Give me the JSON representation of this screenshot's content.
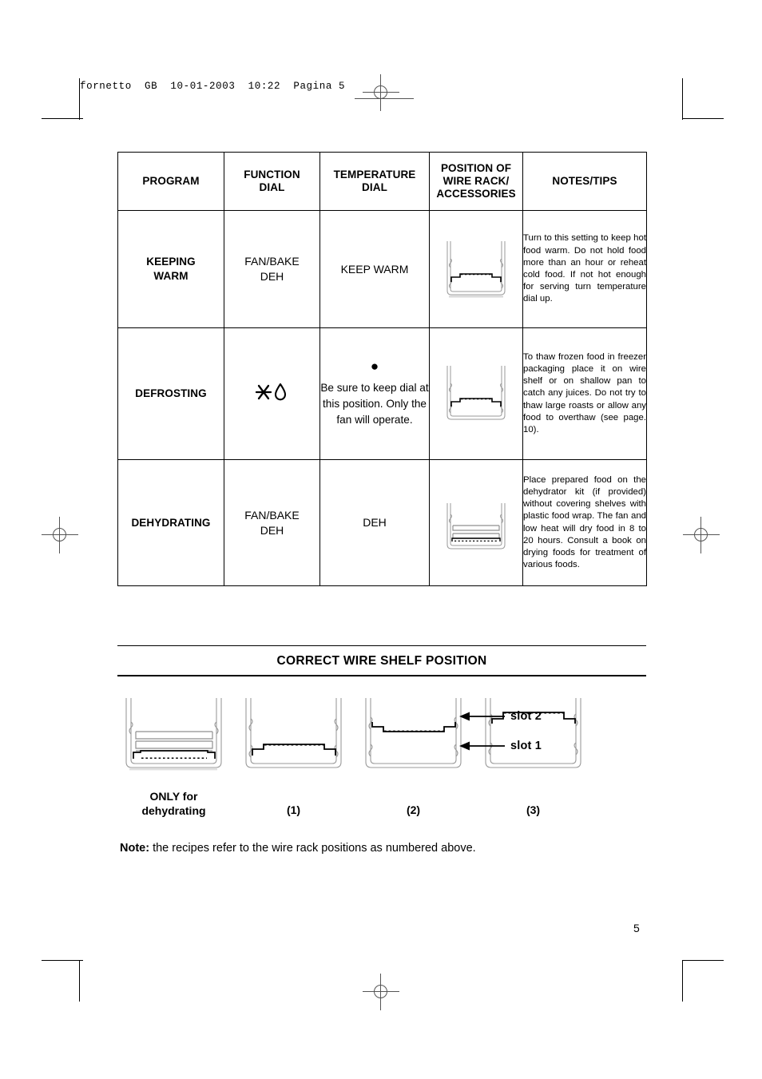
{
  "page": {
    "slug": "fornetto  GB  10-01-2003  10:22  Pagina 5",
    "number": "5"
  },
  "table": {
    "headers": [
      "PROGRAM",
      "FUNCTION\nDIAL",
      "TEMPERATURE\nDIAL",
      "POSITION OF\nWIRE RACK/\nACCESSORIES",
      "NOTES/TIPS"
    ],
    "headers_flat": {
      "program": "PROGRAM",
      "function_dial": "FUNCTION DIAL",
      "temperature_dial": "TEMPERATURE DIAL",
      "position": "POSITION OF WIRE RACK/ ACCESSORIES",
      "notes": "NOTES/TIPS"
    },
    "rows": [
      {
        "program": "KEEPING WARM",
        "function_dial": "FAN/BAKE DEH",
        "temperature_dial": "KEEP WARM",
        "temperature_dot": "",
        "position_icon": "oven-shelf-slot-1-icon",
        "notes": "Turn to this setting to keep hot food warm. Do not hold food more than an hour or reheat cold food. If not hot enough for serving turn temperature dial up."
      },
      {
        "program": "DEFROSTING",
        "function_dial": "✳◊",
        "function_dial_icon": "defrost-snowflake-drop-icon",
        "temperature_dial": "Be sure to keep dial at this position. Only the fan will operate.",
        "temperature_dot": "●",
        "position_icon": "oven-shelf-slot-1-icon",
        "notes": "To thaw frozen food in freezer packaging place it on wire shelf or on shallow pan to catch any juices. Do not try to thaw large roasts or allow any food to overthaw (see page. 10)."
      },
      {
        "program": "DEHYDRATING",
        "function_dial": "FAN/BAKE DEH",
        "temperature_dial": "DEH",
        "temperature_dot": "",
        "position_icon": "oven-dehydrator-kit-icon",
        "notes": "Place prepared food on the dehydrator kit (if provided) without covering shelves with plastic food wrap. The fan and low heat will dry food in 8 to 20 hours. Consult a book on drying foods for treatment of various foods."
      }
    ]
  },
  "shelf_section": {
    "title": "CORRECT WIRE SHELF POSITION",
    "diagrams": [
      {
        "icon": "oven-dehydrator-kit-icon",
        "caption": "ONLY for dehydrating"
      },
      {
        "icon": "oven-shelf-position-1-icon",
        "caption": "(1)"
      },
      {
        "icon": "oven-shelf-position-2-icon",
        "caption": "(2)"
      },
      {
        "icon": "oven-shelf-position-3-icon",
        "caption": "(3)"
      }
    ],
    "slot_labels": [
      {
        "name": "slot 2",
        "icon": "arrow-left-icon"
      },
      {
        "name": "slot 1",
        "icon": "arrow-left-icon"
      }
    ],
    "note_label": "Note:",
    "note_text": " the recipes refer to the wire rack positions as numbered above."
  },
  "colors": {
    "ink": "#000000",
    "paper": "#ffffff",
    "rule_gray": "#555555",
    "diagram_outline": "#9a9a9a"
  }
}
